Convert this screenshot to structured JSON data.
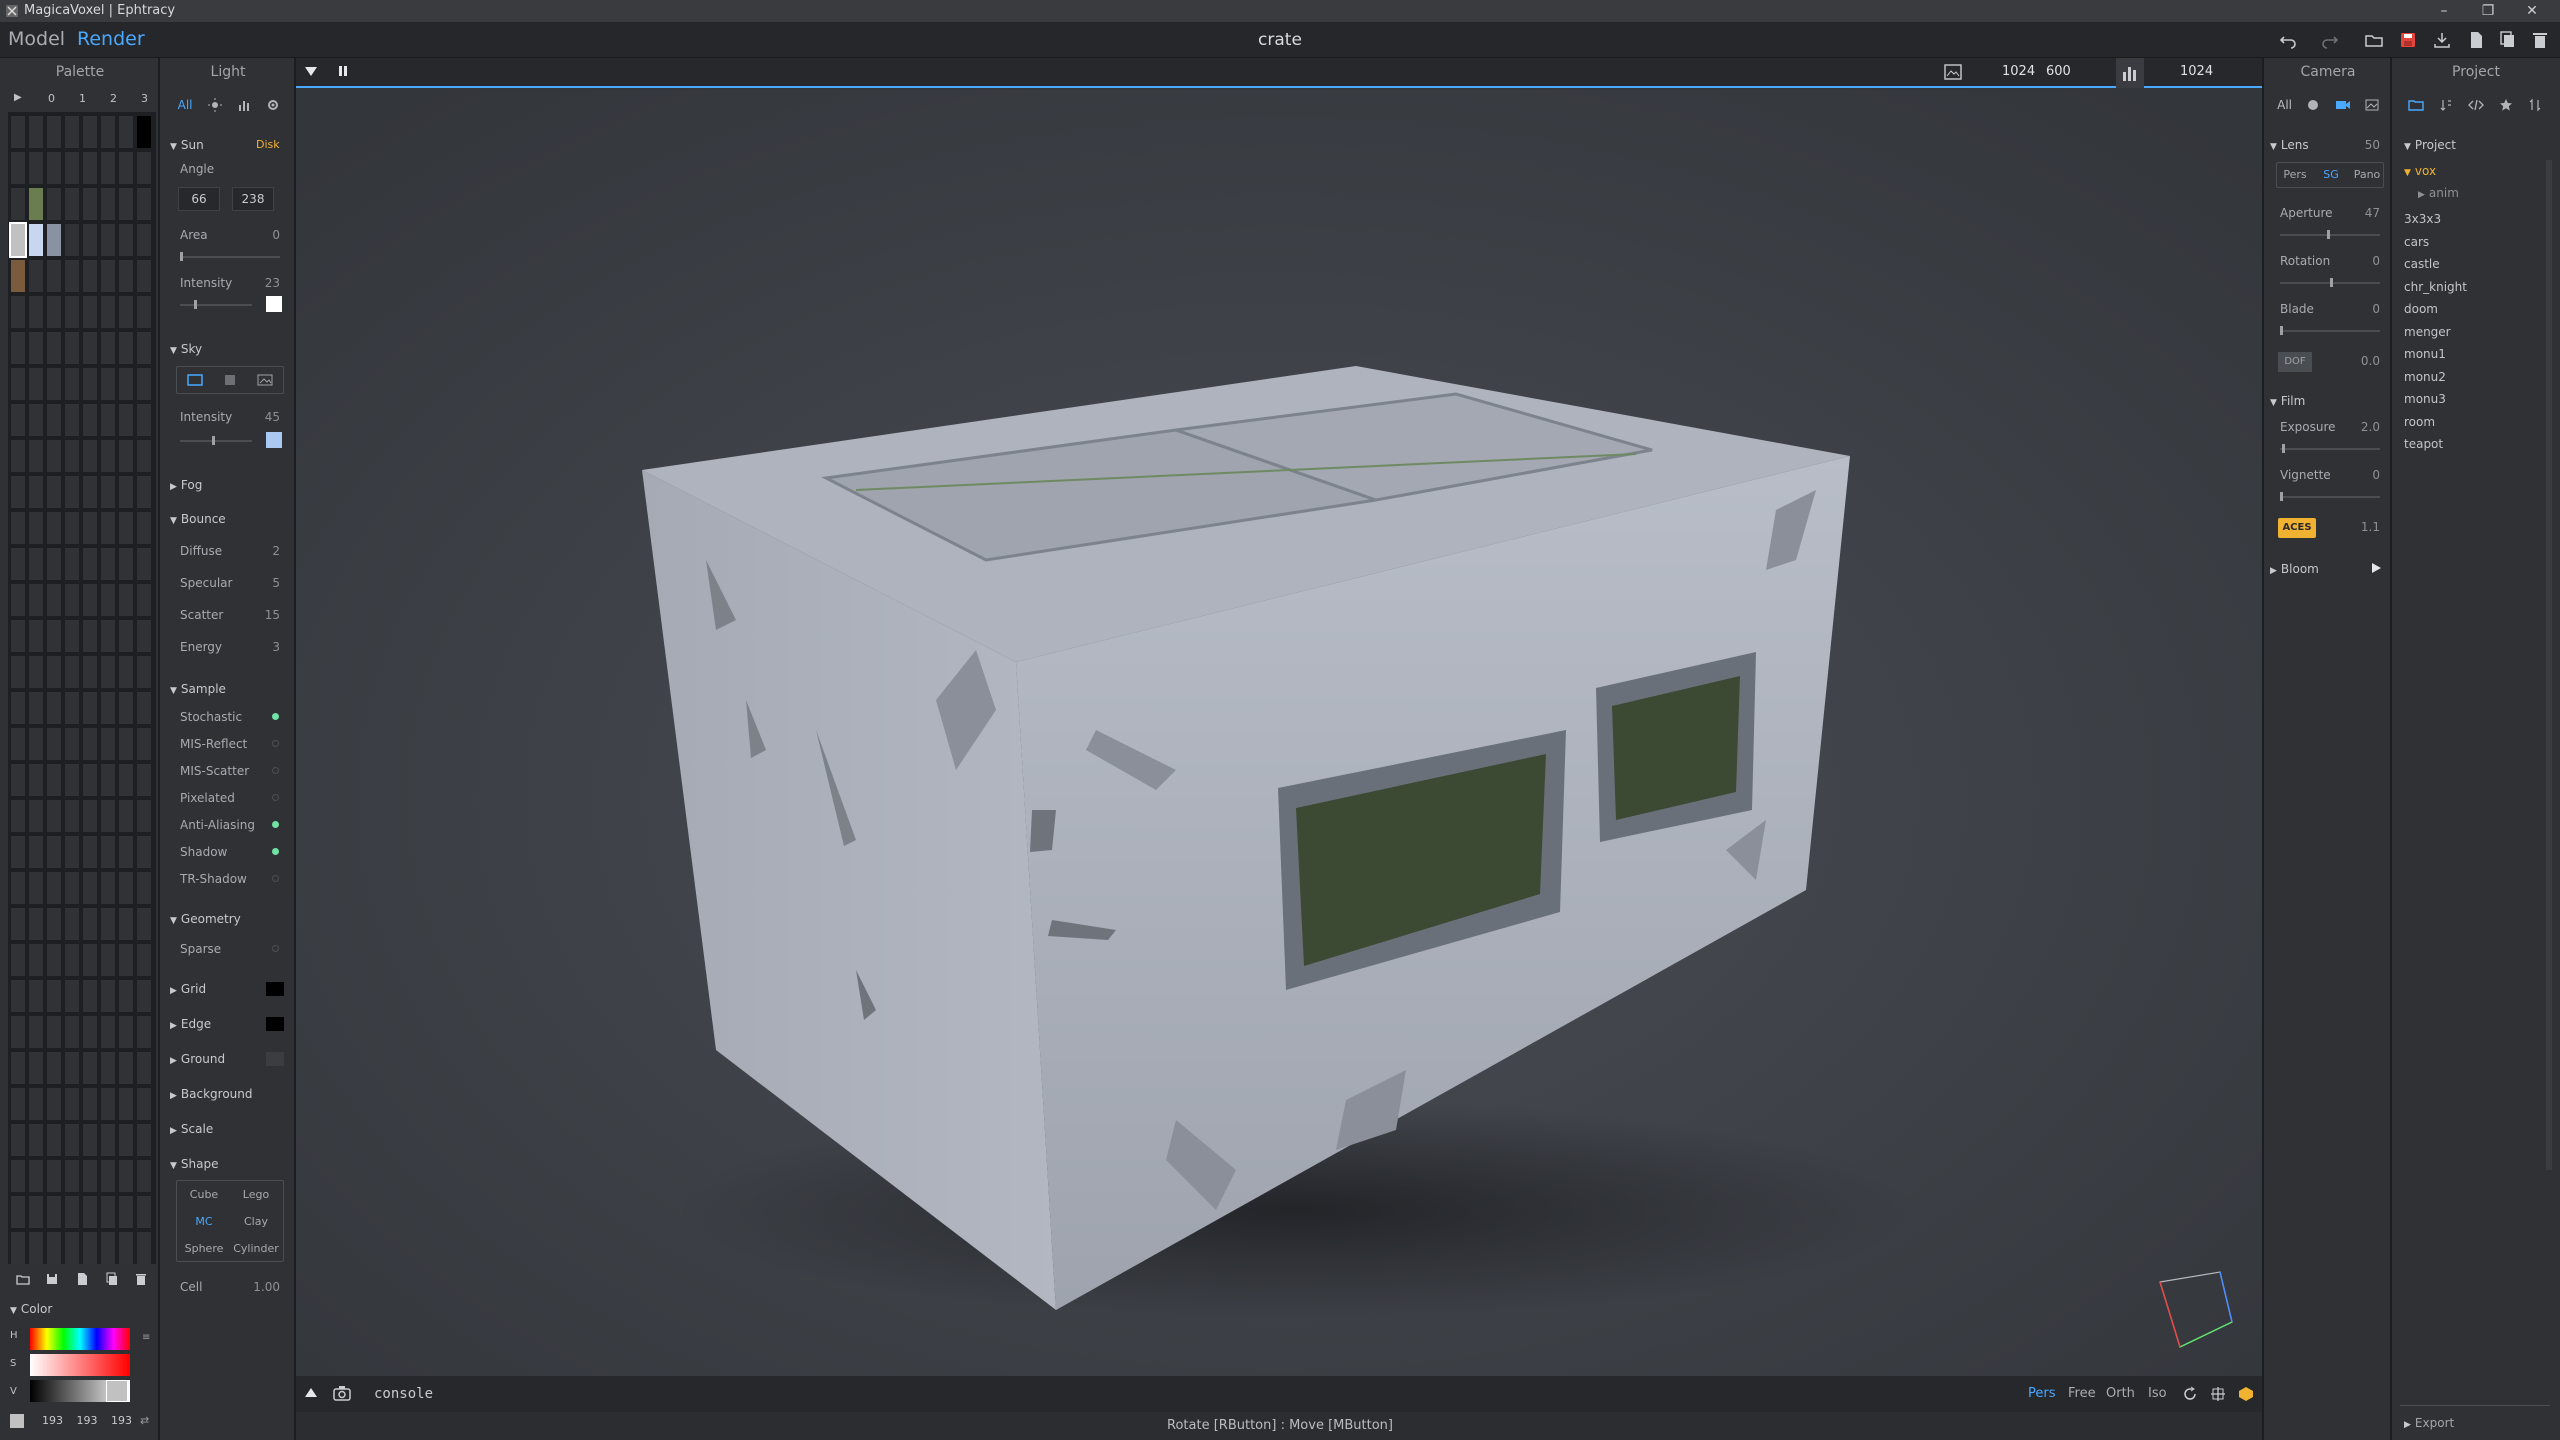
{
  "window": {
    "title": "MagicaVoxel | Ephtracy"
  },
  "menubar": {
    "model": "Model",
    "render": "Render",
    "doc_title": "crate"
  },
  "palette": {
    "title": "Palette",
    "play": "▶",
    "pages": [
      "0",
      "1",
      "2",
      "3"
    ],
    "colors": {
      "gray": "#c1c1c1",
      "lightblue": "#c7d7f0",
      "olive": "#6a7d4e",
      "brown": "#7a5b3e",
      "dark": "#303236"
    },
    "color_section": "Color",
    "hsv": {
      "h": "H",
      "s": "S",
      "v": "V"
    },
    "rgb": [
      "193",
      "193",
      "193"
    ]
  },
  "light": {
    "title": "Light",
    "tabs": {
      "all": "All"
    },
    "sun": {
      "label": "Sun",
      "mode": "Disk",
      "angle_label": "Angle",
      "angle": [
        "66",
        "238"
      ],
      "area_label": "Area",
      "area": "0",
      "intensity_label": "Intensity",
      "intensity": "23"
    },
    "sky": {
      "label": "Sky",
      "intensity_label": "Intensity",
      "intensity": "45",
      "swatch": "#a9c8f2"
    },
    "fog": {
      "label": "Fog"
    },
    "bounce": {
      "label": "Bounce",
      "diffuse_label": "Diffuse",
      "diffuse": "2",
      "specular_label": "Specular",
      "specular": "5",
      "scatter_label": "Scatter",
      "scatter": "15",
      "energy_label": "Energy",
      "energy": "3"
    },
    "sample": {
      "label": "Sample",
      "stochastic": "Stochastic",
      "mis_reflect": "MIS-Reflect",
      "mis_scatter": "MIS-Scatter",
      "pixelated": "Pixelated",
      "anti_aliasing": "Anti-Aliasing",
      "shadow": "Shadow",
      "tr_shadow": "TR-Shadow"
    },
    "geometry": {
      "label": "Geometry",
      "sparse": "Sparse",
      "grid": "Grid",
      "edge": "Edge",
      "ground": "Ground",
      "background": "Background",
      "scale": "Scale"
    },
    "shape": {
      "label": "Shape",
      "cube": "Cube",
      "lego": "Lego",
      "mc": "MC",
      "clay": "Clay",
      "sphere": "Sphere",
      "cylinder": "Cylinder",
      "cell_label": "Cell",
      "cell": "1.00"
    }
  },
  "viewport": {
    "size_w": "1024",
    "size_h": "600",
    "samples": "1024",
    "console": "console",
    "view_modes": {
      "pers": "Pers",
      "free": "Free",
      "orth": "Orth",
      "iso": "Iso"
    },
    "status": "Rotate [RButton] : Move [MButton]",
    "crate_colors": {
      "body": "#b9bec8",
      "shade": "#8a8f99",
      "dark": "#6e737c",
      "window": "#3c4a33",
      "top": "#aeb3bd"
    }
  },
  "camera": {
    "title": "Camera",
    "tabs": {
      "all": "All"
    },
    "lens": {
      "label": "Lens",
      "value": "50",
      "pers": "Pers",
      "sg": "SG",
      "pano": "Pano"
    },
    "aperture_label": "Aperture",
    "aperture": "47",
    "rotation_label": "Rotation",
    "rotation": "0",
    "blade_label": "Blade",
    "blade": "0",
    "dof_label": "DOF",
    "dof": "0.0",
    "film": {
      "label": "Film",
      "exposure_label": "Exposure",
      "exposure": "2.0",
      "vignette_label": "Vignette",
      "vignette": "0",
      "aces": "ACES",
      "aces_val": "1.1"
    },
    "bloom": "Bloom",
    "accent": "#f2b231"
  },
  "project": {
    "title": "Project",
    "root": "Project",
    "folder": "vox",
    "subfolder": "anim",
    "files": [
      "3x3x3",
      "cars",
      "castle",
      "chr_knight",
      "doom",
      "menger",
      "monu1",
      "monu2",
      "monu3",
      "room",
      "teapot"
    ],
    "export": "Export"
  }
}
